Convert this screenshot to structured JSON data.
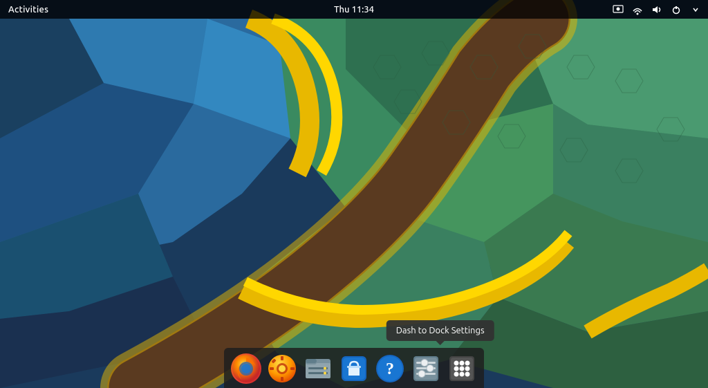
{
  "topbar": {
    "activities_label": "Activities",
    "clock": "Thu 11:34",
    "tray_icons": [
      {
        "name": "screen-icon",
        "symbol": "⬜"
      },
      {
        "name": "network-icon",
        "symbol": "🔗"
      },
      {
        "name": "volume-icon",
        "symbol": "🔊"
      },
      {
        "name": "power-icon",
        "symbol": "⏻"
      }
    ]
  },
  "tooltip": {
    "text": "Dash to Dock Settings"
  },
  "dock": {
    "icons": [
      {
        "id": "firefox",
        "label": "Firefox"
      },
      {
        "id": "settings",
        "label": "System Settings"
      },
      {
        "id": "files",
        "label": "Files"
      },
      {
        "id": "store",
        "label": "Software Center"
      },
      {
        "id": "help",
        "label": "Help"
      },
      {
        "id": "dash",
        "label": "Dash to Dock Settings"
      },
      {
        "id": "grid",
        "label": "Show Applications"
      }
    ]
  }
}
